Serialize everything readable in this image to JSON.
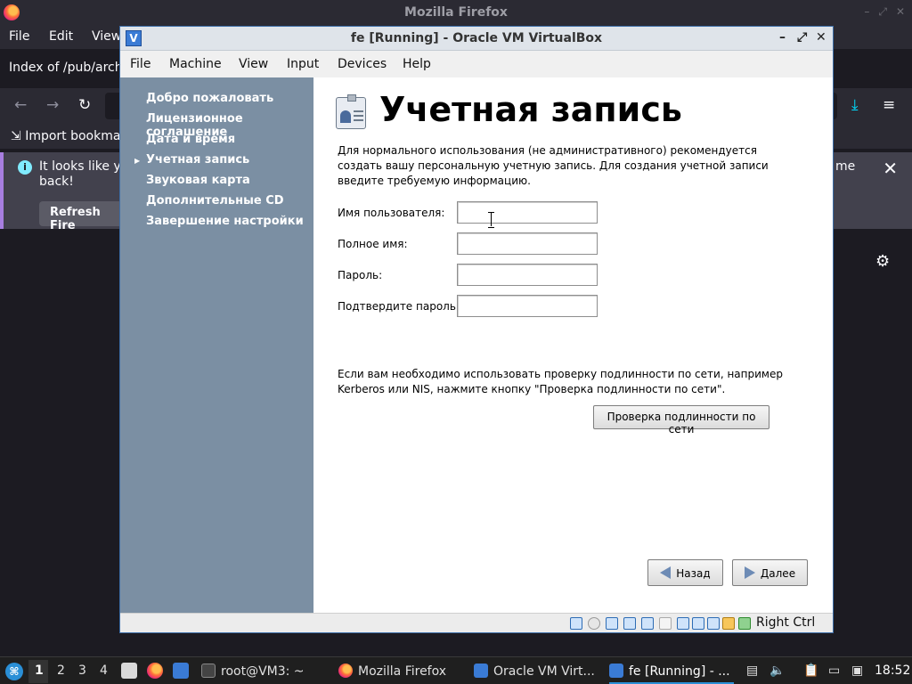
{
  "firefox": {
    "title": "Mozilla Firefox",
    "menu": [
      "File",
      "Edit",
      "View"
    ],
    "tab_title": "Index of /pub/arch",
    "bookmark_item": "Import bookma",
    "notice_line1": "It looks like yo",
    "notice_line2": "back!",
    "notice_tail": "me",
    "refresh_label": "Refresh Fire",
    "close_glyph": "✕"
  },
  "vbox": {
    "title": "fe [Running] - Oracle VM VirtualBox",
    "menu": [
      "File",
      "Machine",
      "View",
      "Input",
      "Devices",
      "Help"
    ],
    "host_key": "Right Ctrl",
    "window_buttons": [
      "–",
      "⤢",
      "✕"
    ]
  },
  "installer": {
    "steps": [
      "Добро пожаловать",
      "Лицензионное соглашение",
      "Дата и время",
      "Учетная запись",
      "Звуковая карта",
      "Дополнительные CD",
      "Завершение настройки"
    ],
    "current_step_marker": "▶",
    "title": "Учетная запись",
    "intro": "Для нормального использования (не административного) рекомендуется создать вашу персональную учетную запись.  Для создания учетной записи введите требуемую информацию.",
    "fields": [
      {
        "label": "Имя пользователя:",
        "value": ""
      },
      {
        "label": "Полное имя:",
        "value": ""
      },
      {
        "label": "Пароль:",
        "value": ""
      },
      {
        "label": "Подтвердите пароль:",
        "value": ""
      }
    ],
    "network_text": "Если вам необходимо использовать проверку подлинности по сети, например Kerberos или NIS, нажмите кнопку \"Проверка подлинности по сети\".",
    "network_button": "Проверка подлинности по сети",
    "back_button": "Назад",
    "next_button": "Далее"
  },
  "taskbar": {
    "workspaces": [
      "1",
      "2",
      "3",
      "4"
    ],
    "tasks": [
      "root@VM3: ~",
      "Mozilla Firefox",
      "Oracle VM Virt...",
      "fe [Running] - ..."
    ],
    "clock": "18:52"
  },
  "colors": {
    "sidebar": "#7b8fa3",
    "vbox_border": "#3d6ea8",
    "taskbar_accent": "#2a8fd6"
  }
}
